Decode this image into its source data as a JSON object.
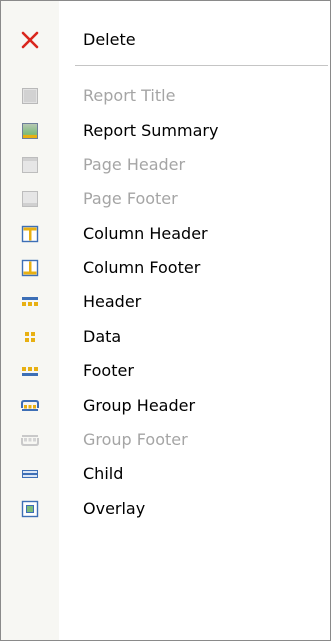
{
  "menu": {
    "items": [
      {
        "label": "Delete",
        "icon": "delete-x-icon",
        "enabled": true
      },
      {
        "label": "Report Title",
        "icon": "report-title-icon",
        "enabled": false
      },
      {
        "label": "Report Summary",
        "icon": "report-summary-icon",
        "enabled": true
      },
      {
        "label": "Page Header",
        "icon": "page-header-icon",
        "enabled": false
      },
      {
        "label": "Page Footer",
        "icon": "page-footer-icon",
        "enabled": false
      },
      {
        "label": "Column Header",
        "icon": "column-header-icon",
        "enabled": true
      },
      {
        "label": "Column Footer",
        "icon": "column-footer-icon",
        "enabled": true
      },
      {
        "label": "Header",
        "icon": "header-band-icon",
        "enabled": true
      },
      {
        "label": "Data",
        "icon": "data-band-icon",
        "enabled": true
      },
      {
        "label": "Footer",
        "icon": "footer-band-icon",
        "enabled": true
      },
      {
        "label": "Group Header",
        "icon": "group-header-icon",
        "enabled": true
      },
      {
        "label": "Group Footer",
        "icon": "group-footer-icon",
        "enabled": false
      },
      {
        "label": "Child",
        "icon": "child-band-icon",
        "enabled": true
      },
      {
        "label": "Overlay",
        "icon": "overlay-band-icon",
        "enabled": true
      }
    ]
  },
  "colors": {
    "delete_red": "#d9261c",
    "disabled_text": "#a5a5a5",
    "band_blue": "#3d6fb6",
    "band_gold": "#e8b012"
  }
}
